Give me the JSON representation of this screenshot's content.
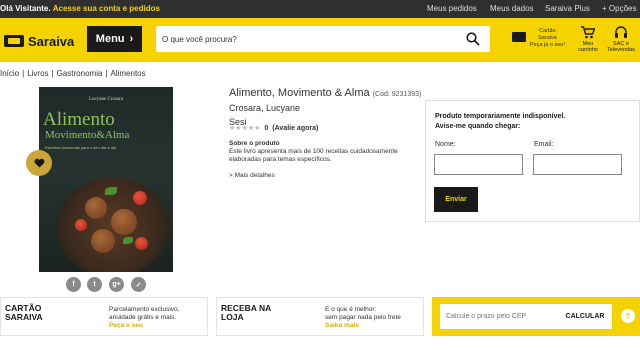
{
  "topbar": {
    "greeting": "Olá Visitante.",
    "cta": "Acesse sua conta e pedidos",
    "links": [
      "Meus pedidos",
      "Meus dados",
      "Saraiva Plus",
      "+ Opções"
    ]
  },
  "header": {
    "logo": "Saraiva",
    "menu_label": "Menu",
    "search_placeholder": "O que você procura?",
    "card_line1": "Cartão",
    "card_line2": "Saraiva",
    "card_cta": "Peça já o seu!",
    "cart_label": "Meu carrinho",
    "sac_label": "SAC e Televendas"
  },
  "breadcrumb": [
    "Início",
    "Livros",
    "Gastronomia",
    "Alimentos"
  ],
  "cover": {
    "author": "Lucyane Crosara",
    "title_line1": "Alimento",
    "title_line2": "Movimento&Alma",
    "subtitle": "Receitas funcionais para o seu dia a dia"
  },
  "product": {
    "title": "Alimento, Movimento & Alma",
    "code": "(Cód: 9231393)",
    "author": "Crosara, Lucyane",
    "publisher": "Sesi",
    "rating_count": "0",
    "rating_cta": "(Avalie agora)",
    "about_heading": "Sobre o produto",
    "about_text": "Este livro apresenta mais de 100 receitas cuidadosamente elaboradas para temas específicos.",
    "more_details": "> Mais detalhes"
  },
  "share_icons": [
    "f",
    "t",
    "g+",
    "✓"
  ],
  "notify": {
    "heading_line1": "Produto temporariamente indisponível.",
    "heading_line2": "Avise-me quando chegar:",
    "name_label": "Nome:",
    "email_label": "Email:",
    "send_label": "Enviar"
  },
  "bottom": {
    "card_title_1": "CARTÃO",
    "card_title_2": "SARAIVA",
    "card_desc_1": "Parcelamento exclusivo,",
    "card_desc_2": "anuidade grátis e mais.",
    "card_link": "Peça o seu",
    "store_title_1": "RECEBA NA",
    "store_title_2": "LOJA",
    "store_desc_1": "E o que é melhor:",
    "store_desc_2": "sem pagar nada pelo frete",
    "store_link": "Saiba mais",
    "cep_placeholder": "Calcule o prazo pelo CEP",
    "calc_label": "CALCULAR",
    "info_symbol": "?"
  },
  "colors": {
    "brand_yellow": "#f5d300",
    "dark": "#1a1a1a",
    "topbar": "#2f2f2f"
  }
}
